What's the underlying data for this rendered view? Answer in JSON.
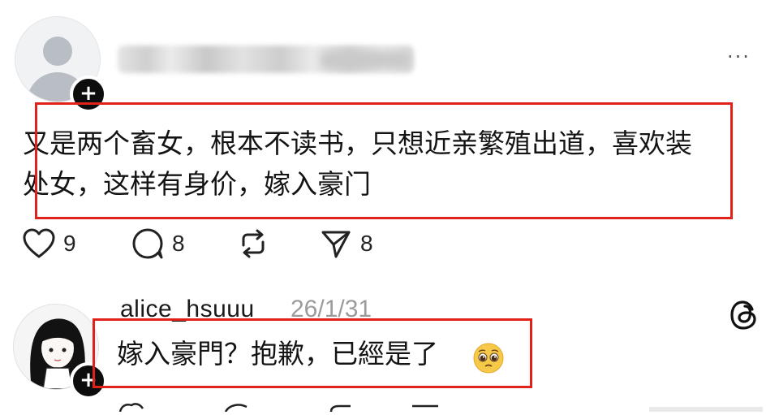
{
  "post1": {
    "username_redacted": true,
    "text_line1": "又是两个畜女，根本不读书，只想近亲繁殖出道，喜欢装",
    "text_line2": "处女，这样有身价，嫁入豪门",
    "actions": {
      "like_count": "9",
      "comment_count": "8",
      "share_count": "8"
    },
    "more_label": "···"
  },
  "post2": {
    "username": "alice_hsuuu",
    "date": "26/1/31",
    "text": "嫁入豪門？抱歉，已經是了"
  },
  "icons": {
    "heart": "heart-icon",
    "comment": "comment-icon",
    "repost": "repost-icon",
    "send": "send-icon",
    "threads": "threads-logo-icon",
    "pleading": "pleading-face-emoji"
  },
  "colors": {
    "highlight_box": "#e0221a",
    "text": "#141414",
    "muted": "#9b9b9b"
  }
}
